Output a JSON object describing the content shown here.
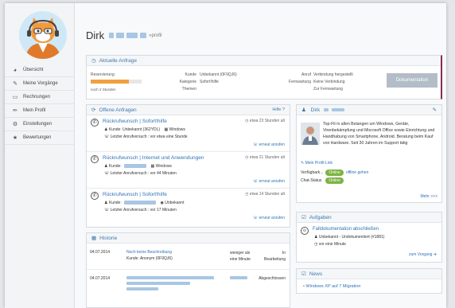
{
  "sidebar": {
    "items": [
      {
        "label": "Übersicht",
        "icon": "dashboard-icon"
      },
      {
        "label": "Meine Vorgänge",
        "icon": "wrench-icon"
      },
      {
        "label": "Rechnungen",
        "icon": "invoice-icon"
      },
      {
        "label": "Mein Profil",
        "icon": "pencil-icon"
      },
      {
        "label": "Einstellungen",
        "icon": "gear-icon"
      },
      {
        "label": "Bewertungen",
        "icon": "star-icon"
      }
    ]
  },
  "header": {
    "name": "Dirk",
    "suffix": "»profil"
  },
  "current": {
    "title": "Aktuelle Anfrage",
    "reservation_label": "Reservierung",
    "reservation_note": "noch 2 Stunden",
    "progress": 0.75,
    "customer_label": "Kunde",
    "customer_value": "Unbekannt (0F9QJ6)",
    "category_label": "Kategorie",
    "category_value": "Sofort!hilfe",
    "topics_label": "Themen",
    "call_label": "Anruf",
    "call_value": "Verbindung hergestellt",
    "remote_label": "Fernwartung",
    "remote_value": "Keine Verbindung",
    "remote_link": "Zur Fernwartung",
    "doc_button": "Dokumentation"
  },
  "open": {
    "title": "Offene Anfragen",
    "help": "Hilfe ?",
    "items": [
      {
        "title": "Rückrufwunsch | Sofort!hilfe",
        "time": "etwa 23 Stunden alt",
        "customer": "Kunde: Unbekannt (362YDL)",
        "os": "Windows",
        "last": "Letzter Anrufversuch : vor etwa eine Stunde",
        "action": "erneut anrufen"
      },
      {
        "title": "Rückrufwunsch | Internet und Anwendungen",
        "time": "etwa 21 Stunden alt",
        "customer": "Kunde:",
        "os": "Windows",
        "last": "Letzter Anrufversuch : vor 44 Minuten",
        "action": "erneut anrufen"
      },
      {
        "title": "Rückrufwunsch | Sofort!hilfe",
        "time": "etwa 14 Stunden alt",
        "customer": "Kunde:",
        "os": "Unbekannt",
        "last": "Letzter Anrufversuch : vor 17 Minuten",
        "action": "erneut anrufen"
      }
    ]
  },
  "history": {
    "title": "Historie",
    "rows": [
      {
        "date": "04.07.2014",
        "desc": "Noch keine Beschreibung",
        "customer": "Kunde: Anonym (0F9QJ6)",
        "duration": "weniger als eine Minute",
        "status": "In Bearbeitung"
      },
      {
        "date": "04.07.2014",
        "status": "Abgeschlossen"
      }
    ]
  },
  "profile": {
    "title": "Dirk",
    "text": "Top-Fit in allen Belangen um Windows, Geräte, Virenbekämpfung und Microsoft Office sowie Einrichtung und Handhabung von Smartphone, Android. Beratung beim Kauf von Hardware. Seit 30 Jahren im Support tätig",
    "profile_link": "Mein Profil-Link",
    "availability_label": "Verfügbark...",
    "availability_badge": "Online",
    "availability_link": "offline gehen",
    "chat_label": "Chat-Status",
    "chat_badge": "Online",
    "more": "Mehr >>>"
  },
  "tasks": {
    "title": "Aufgaben",
    "item_title": "Falldokumentation abschließen",
    "item_customer": "Unbekannt - Undokumentiert (#1881)",
    "item_time": "vor eine Minute",
    "action": "zum Vorgang"
  },
  "news": {
    "title": "News",
    "item": "Windows XP auf 7 Migration"
  },
  "colors": {
    "accent": "#2f73b5",
    "online": "#7cb342",
    "progress": "#f0a040"
  }
}
